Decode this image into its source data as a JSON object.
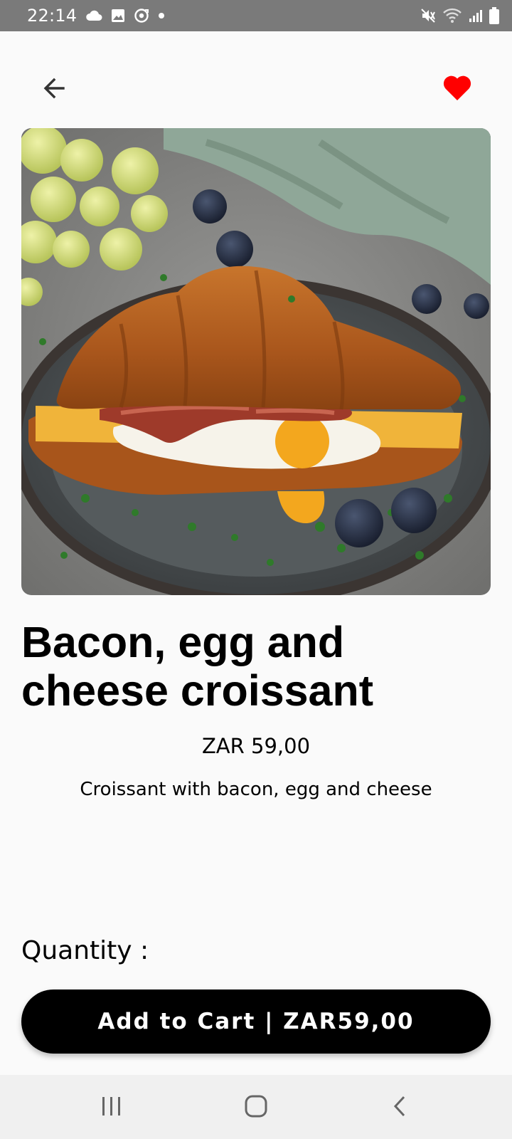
{
  "status_bar": {
    "time": "22:14",
    "left_icons": [
      "cloud-icon",
      "image-icon",
      "sync-icon",
      "dot-icon"
    ],
    "right_icons": [
      "mute-icon",
      "wifi-icon",
      "signal-icon",
      "battery-icon"
    ]
  },
  "top_bar": {
    "back_icon": "arrow-left-icon",
    "favorite_icon": "heart-icon",
    "favorite_color": "#ff0000"
  },
  "product": {
    "image_alt": "photo",
    "title": "Bacon, egg and cheese croissant",
    "price": "ZAR 59,00",
    "description": "Croissant with bacon, egg and cheese"
  },
  "quantity": {
    "label": "Quantity :"
  },
  "cart_button": {
    "label": "Add to Cart | ZAR59,00"
  },
  "nav_bar": {
    "items": [
      "recents-icon",
      "home-icon",
      "back-icon"
    ]
  },
  "colors": {
    "status_bar": "#7a7a7a",
    "background": "#fafafa",
    "button": "#000000",
    "button_text": "#ffffff",
    "nav_bar": "#f0f0f0"
  }
}
